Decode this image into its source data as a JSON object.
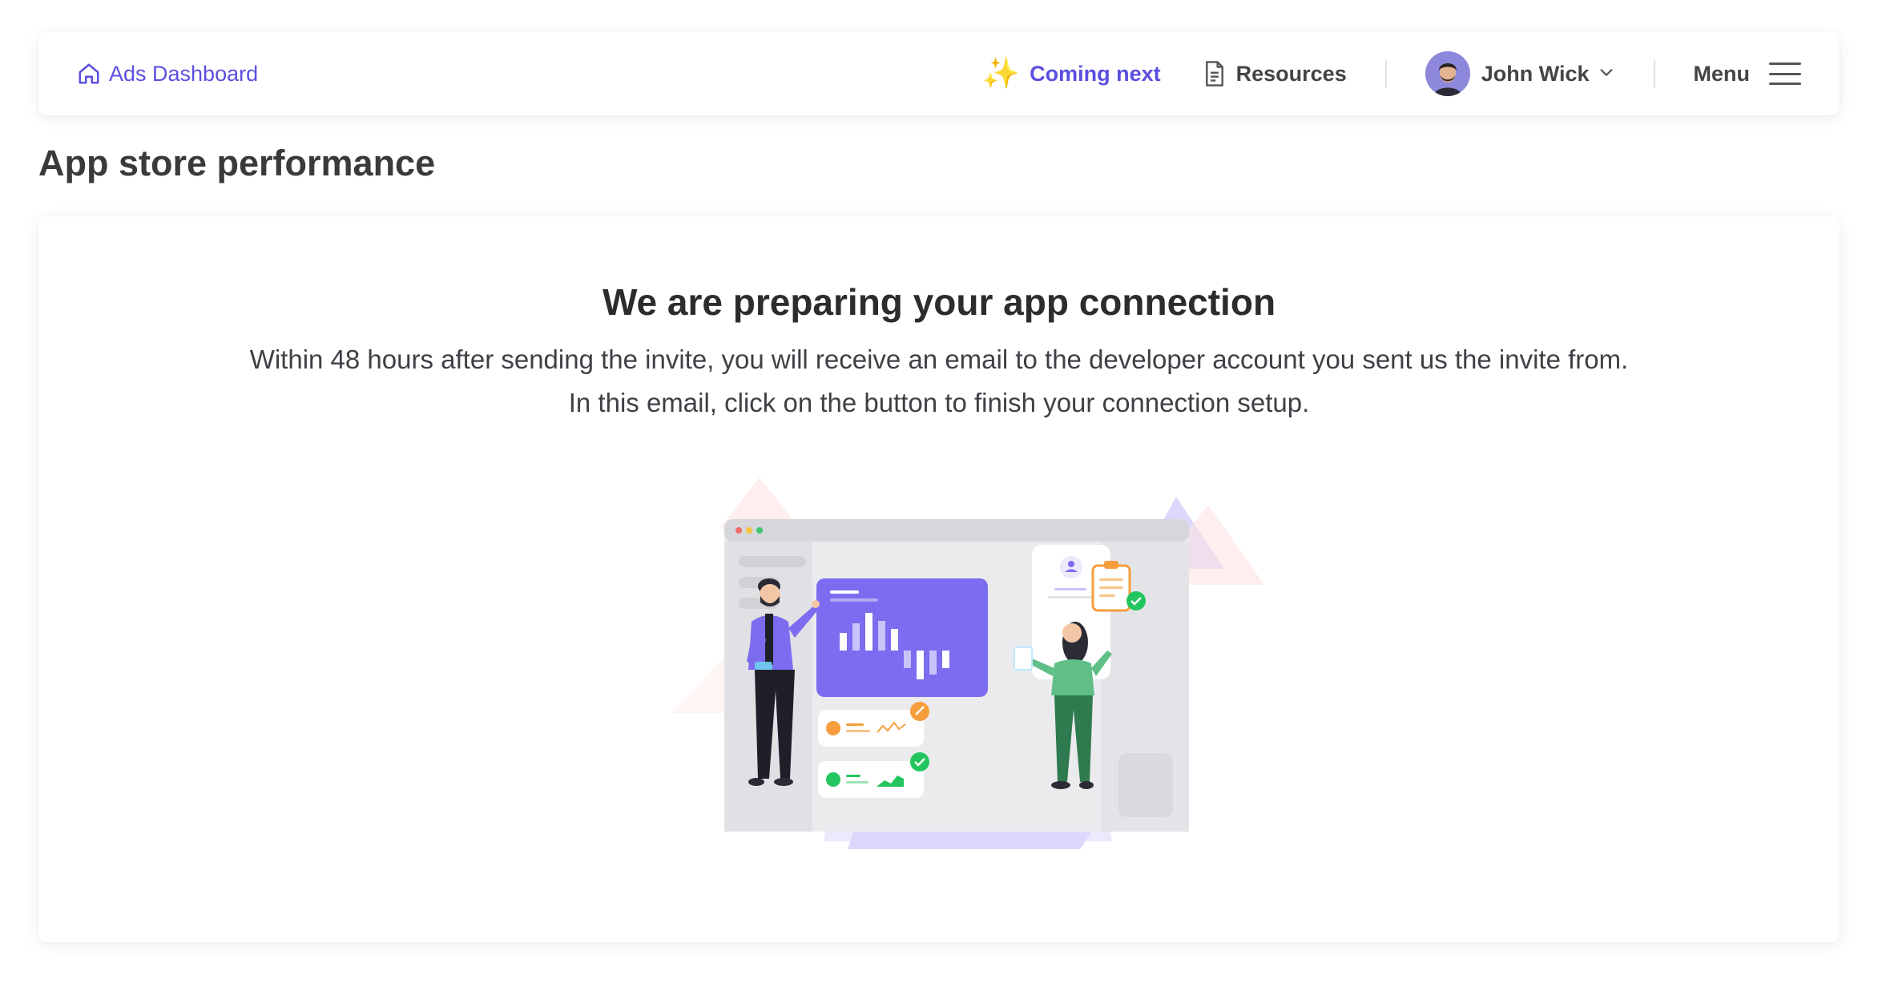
{
  "topbar": {
    "home_label": "Ads Dashboard",
    "coming_next_label": "Coming next",
    "resources_label": "Resources",
    "user_name": "John Wick",
    "menu_label": "Menu"
  },
  "page": {
    "title": "App store performance"
  },
  "card": {
    "heading": "We are preparing your app connection",
    "line1": "Within 48 hours after sending the invite, you will receive an email to the developer account you sent us the invite from.",
    "line2": "In this email, click on the button to finish your connection setup."
  },
  "icons": {
    "home": "home-icon",
    "coming_next": "sparkles-icon",
    "resources": "document-icon",
    "user_menu": "chevron-down-icon",
    "menu": "hamburger-icon"
  },
  "colors": {
    "accent": "#5b4fe0",
    "sparkle": "#f5c43c",
    "illustration_purple": "#7b6cf0",
    "illustration_green": "#22c55e",
    "illustration_orange": "#f59e3b"
  }
}
